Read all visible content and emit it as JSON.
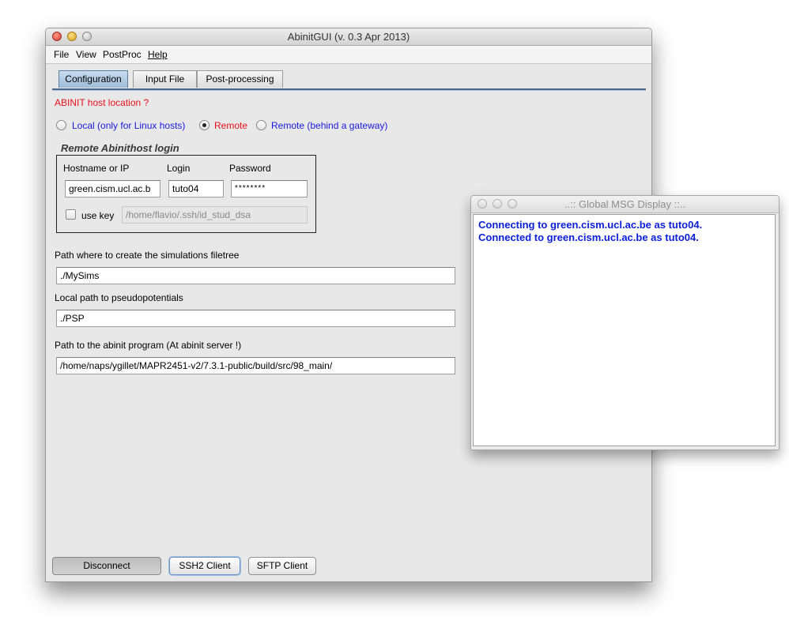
{
  "main_window": {
    "title": "AbinitGUI (v. 0.3 Apr 2013)",
    "menu": [
      "File",
      "View",
      "PostProc",
      "Help"
    ],
    "tabs": [
      {
        "label": "Configuration",
        "active": true
      },
      {
        "label": "Input File",
        "active": false
      },
      {
        "label": "Post-processing",
        "active": false
      }
    ]
  },
  "config": {
    "host_location_label": "ABINIT host location ?",
    "host_location_color": "#e8101a",
    "radio_options": [
      {
        "label": "Local (only for Linux hosts)",
        "selected": false,
        "color": "#1a1adf"
      },
      {
        "label": "Remote",
        "selected": true,
        "color": "#e8101a"
      },
      {
        "label": "Remote (behind a gateway)",
        "selected": false,
        "color": "#1a1adf"
      }
    ],
    "login_section_title": "Remote Abinithost login",
    "hostname_label": "Hostname or IP",
    "login_label": "Login",
    "password_label": "Password",
    "hostname_value": "green.cism.ucl.ac.b",
    "login_value": "tuto04",
    "password_value": "********",
    "use_key_label": "use key",
    "use_key_checked": false,
    "key_path_value": "/home/flavio/.ssh/id_stud_dsa",
    "sim_path_label": "Path where to create the simulations filetree",
    "sim_path_value": "./MySims",
    "pseudo_path_label": "Local path to pseudopotentials",
    "pseudo_path_value": "./PSP",
    "abinit_path_label": "Path to the abinit program (At abinit server !)",
    "abinit_path_value": "/home/naps/ygillet/MAPR2451-v2/7.3.1-public/build/src/98_main/"
  },
  "buttons": {
    "disconnect": "Disconnect",
    "ssh2": "SSH2 Client",
    "sftp": "SFTP Client"
  },
  "msg_window": {
    "title": "..:: Global MSG Display ::..",
    "lines": [
      "Connecting to green.cism.ucl.ac.be as tuto04.",
      "Connected to green.cism.ucl.ac.be as tuto04."
    ],
    "text_color": "#0a1ed8"
  }
}
